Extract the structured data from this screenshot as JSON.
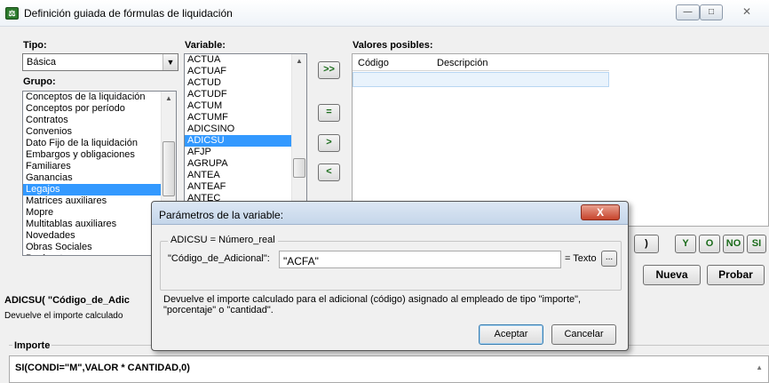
{
  "window": {
    "title": "Definición guiada de fórmulas de liquidación",
    "icon": "app-icon",
    "controls": {
      "minimize": "—",
      "maximize": "□",
      "close": "✕"
    }
  },
  "tipo": {
    "label": "Tipo:",
    "value": "Básica"
  },
  "grupo": {
    "label": "Grupo:",
    "items": [
      "Conceptos de la liquidación",
      "Conceptos por período",
      "Contratos",
      "Convenios",
      "Dato Fijo de la liquidación",
      "Embargos y obligaciones",
      "Familiares",
      "Ganancias",
      "Legajos",
      "Matrices auxiliares",
      "Mopre",
      "Multitablas auxiliares",
      "Novedades",
      "Obras Sociales",
      "Parámetros"
    ],
    "selected": "Legajos"
  },
  "variable": {
    "label": "Variable:",
    "items": [
      "ACTUA",
      "ACTUAF",
      "ACTUD",
      "ACTUDF",
      "ACTUM",
      "ACTUMF",
      "ADICSINO",
      "ADICSU",
      "AFJP",
      "AGRUPA",
      "ANTEA",
      "ANTEAF",
      "ANTEC"
    ],
    "selected": "ADICSU"
  },
  "side_buttons": {
    "all": ">>",
    "eq": "=",
    "gt": ">",
    "lt": "<"
  },
  "valores": {
    "label": "Valores posibles:",
    "col_codigo": "Código",
    "col_descripcion": "Descripción"
  },
  "logic_buttons": {
    "paren": ")",
    "y": "Y",
    "o": "O",
    "no": "NO",
    "si": "SI"
  },
  "actions": {
    "nueva": "Nueva",
    "probar": "Probar"
  },
  "description": {
    "signature": "ADICSU( \"Código_de_Adic",
    "text": "Devuelve el importe calculado"
  },
  "importe": {
    "legend": "Importe",
    "formula": "SI(CONDI=\"M\",VALOR * CANTIDAD,0)"
  },
  "dialog": {
    "title": "Parámetros de la variable:",
    "close": "X",
    "legend": "ADICSU = Número_real",
    "param_label": "\"Código_de_Adicional\":",
    "param_value": "\"ACFA\"",
    "param_type": "= Texto",
    "ellipsis": "...",
    "help": "Devuelve el importe calculado para el adicional (código) asignado al empleado de tipo \"importe\", \"porcentaje\" o \"cantidad\".",
    "accept": "Aceptar",
    "cancel": "Cancelar"
  }
}
